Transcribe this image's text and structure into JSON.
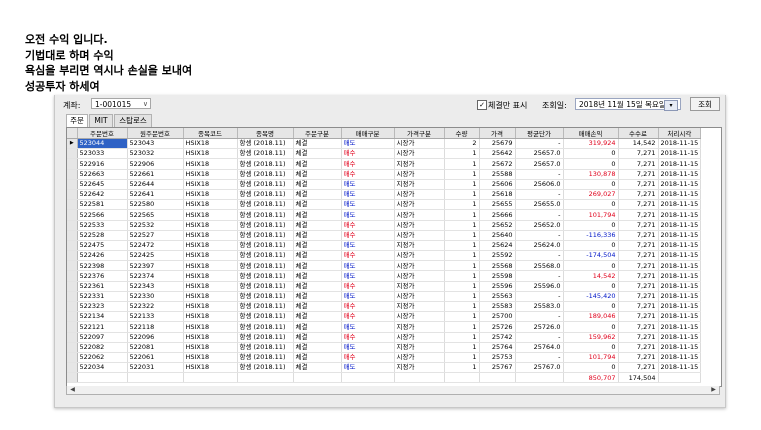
{
  "post": {
    "lines": [
      "오전 수익 입니다.",
      "기법대로 하며 수익",
      "욕심을 부리면 역시나 손실을 보내여",
      "성공투자 하세여"
    ]
  },
  "toolbar": {
    "account_label": "계좌:",
    "account_value": "1-001015",
    "checkbox_label": "체결만 표시",
    "date_label": "조회일:",
    "date_value": "2018년 11월 15일 목요일",
    "query_button": "조회"
  },
  "tabs": [
    "주문",
    "MIT",
    "스탑로스"
  ],
  "table": {
    "columns": [
      "주문번호",
      "원주문번호",
      "종목코드",
      "종목명",
      "주문구분",
      "매매구분",
      "가격구분",
      "수량",
      "가격",
      "평균단가",
      "매매손익",
      "수수료",
      "처리시각"
    ],
    "rows": [
      [
        "523044",
        "523043",
        "HSIX18",
        "항셍 (2018.11)",
        "체결",
        "매도",
        "시장가",
        "2",
        "25679",
        "-",
        "319,924",
        "14,542",
        "2018-11-15"
      ],
      [
        "523033",
        "523032",
        "HSIX18",
        "항셍 (2018.11)",
        "체결",
        "매수",
        "시장가",
        "1",
        "25642",
        "25657.0",
        "0",
        "7,271",
        "2018-11-15"
      ],
      [
        "522916",
        "522906",
        "HSIX18",
        "항셍 (2018.11)",
        "체결",
        "매수",
        "지정가",
        "1",
        "25672",
        "25657.0",
        "0",
        "7,271",
        "2018-11-15"
      ],
      [
        "522663",
        "522661",
        "HSIX18",
        "항셍 (2018.11)",
        "체결",
        "매수",
        "시장가",
        "1",
        "25588",
        "-",
        "130,878",
        "7,271",
        "2018-11-15"
      ],
      [
        "522645",
        "522644",
        "HSIX18",
        "항셍 (2018.11)",
        "체결",
        "매도",
        "지정가",
        "1",
        "25606",
        "25606.0",
        "0",
        "7,271",
        "2018-11-15"
      ],
      [
        "522642",
        "522641",
        "HSIX18",
        "항셍 (2018.11)",
        "체결",
        "매도",
        "시장가",
        "1",
        "25618",
        "-",
        "269,027",
        "7,271",
        "2018-11-15"
      ],
      [
        "522581",
        "522580",
        "HSIX18",
        "항셍 (2018.11)",
        "체결",
        "매도",
        "시장가",
        "1",
        "25655",
        "25655.0",
        "0",
        "7,271",
        "2018-11-15"
      ],
      [
        "522566",
        "522565",
        "HSIX18",
        "항셍 (2018.11)",
        "체결",
        "매도",
        "시장가",
        "1",
        "25666",
        "-",
        "101,794",
        "7,271",
        "2018-11-15"
      ],
      [
        "522533",
        "522532",
        "HSIX18",
        "항셍 (2018.11)",
        "체결",
        "매수",
        "시장가",
        "1",
        "25652",
        "25652.0",
        "0",
        "7,271",
        "2018-11-15"
      ],
      [
        "522528",
        "522527",
        "HSIX18",
        "항셍 (2018.11)",
        "체결",
        "매수",
        "시장가",
        "1",
        "25640",
        "-",
        "-116,336",
        "7,271",
        "2018-11-15"
      ],
      [
        "522475",
        "522472",
        "HSIX18",
        "항셍 (2018.11)",
        "체결",
        "매도",
        "지정가",
        "1",
        "25624",
        "25624.0",
        "0",
        "7,271",
        "2018-11-15"
      ],
      [
        "522426",
        "522425",
        "HSIX18",
        "항셍 (2018.11)",
        "체결",
        "매수",
        "시장가",
        "1",
        "25592",
        "-",
        "-174,504",
        "7,271",
        "2018-11-15"
      ],
      [
        "522398",
        "522397",
        "HSIX18",
        "항셍 (2018.11)",
        "체결",
        "매도",
        "시장가",
        "1",
        "25568",
        "25568.0",
        "0",
        "7,271",
        "2018-11-15"
      ],
      [
        "522376",
        "522374",
        "HSIX18",
        "항셍 (2018.11)",
        "체결",
        "매도",
        "시장가",
        "1",
        "25598",
        "-",
        "14,542",
        "7,271",
        "2018-11-15"
      ],
      [
        "522361",
        "522343",
        "HSIX18",
        "항셍 (2018.11)",
        "체결",
        "매수",
        "지정가",
        "1",
        "25596",
        "25596.0",
        "0",
        "7,271",
        "2018-11-15"
      ],
      [
        "522331",
        "522330",
        "HSIX18",
        "항셍 (2018.11)",
        "체결",
        "매도",
        "시장가",
        "1",
        "25563",
        "-",
        "-145,420",
        "7,271",
        "2018-11-15"
      ],
      [
        "522323",
        "522322",
        "HSIX18",
        "항셍 (2018.11)",
        "체결",
        "매수",
        "지정가",
        "1",
        "25583",
        "25583.0",
        "0",
        "7,271",
        "2018-11-15"
      ],
      [
        "522134",
        "522133",
        "HSIX18",
        "항셍 (2018.11)",
        "체결",
        "매수",
        "시장가",
        "1",
        "25700",
        "-",
        "189,046",
        "7,271",
        "2018-11-15"
      ],
      [
        "522121",
        "522118",
        "HSIX18",
        "항셍 (2018.11)",
        "체결",
        "매도",
        "지정가",
        "1",
        "25726",
        "25726.0",
        "0",
        "7,271",
        "2018-11-15"
      ],
      [
        "522097",
        "522096",
        "HSIX18",
        "항셍 (2018.11)",
        "체결",
        "매수",
        "시장가",
        "1",
        "25742",
        "-",
        "159,962",
        "7,271",
        "2018-11-15"
      ],
      [
        "522082",
        "522081",
        "HSIX18",
        "항셍 (2018.11)",
        "체결",
        "매도",
        "지정가",
        "1",
        "25764",
        "25764.0",
        "0",
        "7,271",
        "2018-11-15"
      ],
      [
        "522062",
        "522061",
        "HSIX18",
        "항셍 (2018.11)",
        "체결",
        "매수",
        "시장가",
        "1",
        "25753",
        "-",
        "101,794",
        "7,271",
        "2018-11-15"
      ],
      [
        "522034",
        "522031",
        "HSIX18",
        "항셍 (2018.11)",
        "체결",
        "매도",
        "지정가",
        "1",
        "25767",
        "25767.0",
        "0",
        "7,271",
        "2018-11-15"
      ]
    ],
    "totals": {
      "pnl": "850,707",
      "fee": "174,504"
    }
  }
}
